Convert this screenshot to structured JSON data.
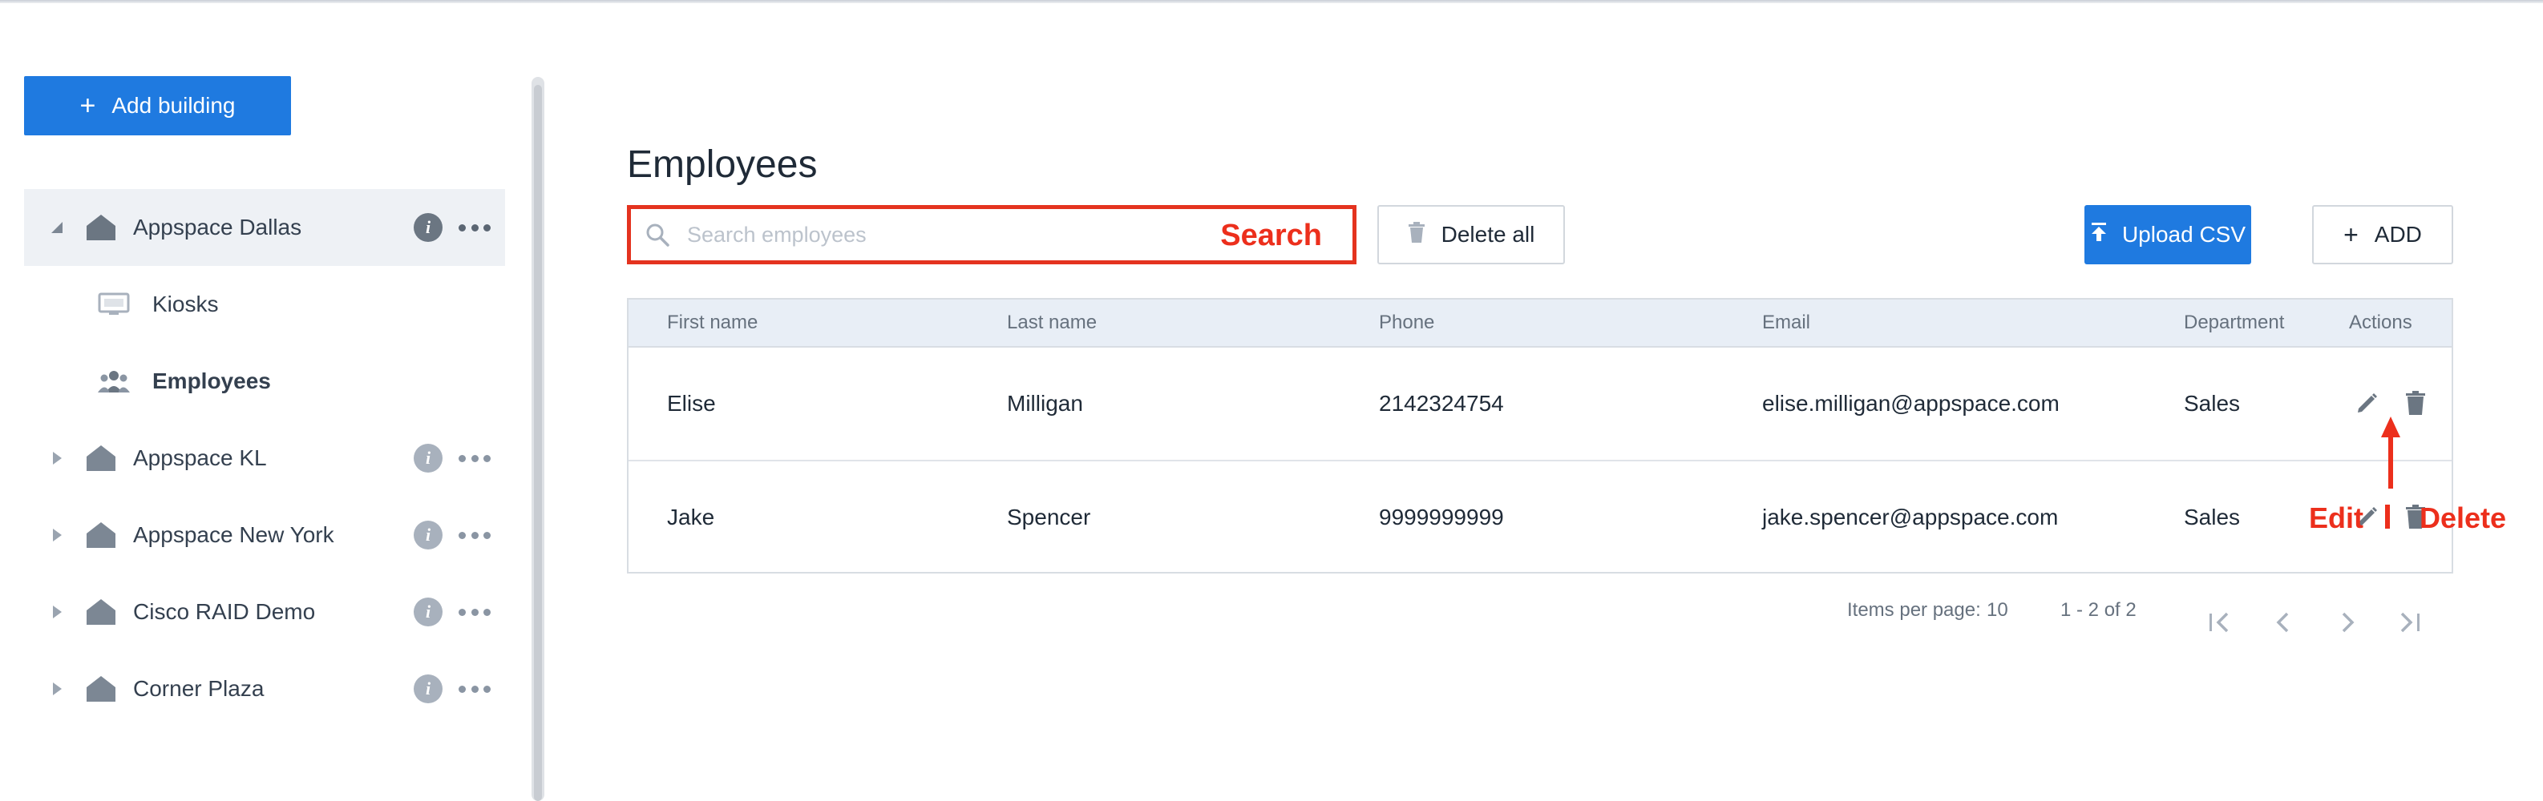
{
  "sidebar": {
    "add_building_label": "Add building",
    "buildings": [
      {
        "label": "Appspace Dallas",
        "expanded": true
      },
      {
        "label": "Appspace KL",
        "expanded": false
      },
      {
        "label": "Appspace New York",
        "expanded": false
      },
      {
        "label": "Cisco RAID Demo",
        "expanded": false
      },
      {
        "label": "Corner Plaza",
        "expanded": false
      }
    ],
    "subitems": [
      {
        "label": "Kiosks",
        "icon": "monitor-icon"
      },
      {
        "label": "Employees",
        "icon": "people-icon",
        "active": true
      }
    ]
  },
  "main": {
    "title": "Employees",
    "search": {
      "placeholder": "Search employees",
      "value": ""
    },
    "delete_all_label": "Delete all",
    "upload_csv_label": "Upload CSV",
    "add_label": "ADD",
    "table": {
      "columns": [
        "First name",
        "Last name",
        "Phone",
        "Email",
        "Department",
        "Actions"
      ],
      "rows": [
        {
          "first": "Elise",
          "last": "Milligan",
          "phone": "2142324754",
          "email": "elise.milligan@appspace.com",
          "department": "Sales"
        },
        {
          "first": "Jake",
          "last": "Spencer",
          "phone": "9999999999",
          "email": "jake.spencer@appspace.com",
          "department": "Sales"
        }
      ]
    },
    "pagination": {
      "items_per_page_label": "Items per page:",
      "items_per_page": "10",
      "range": "1 - 2 of 2"
    }
  },
  "annotations": {
    "search": "Search",
    "edit": "Edit",
    "delete": "Delete"
  },
  "colors": {
    "accent": "#1f7ae0",
    "annotation": "#ec2f1c",
    "header_bg": "#e8eef6",
    "selected_row_bg": "#eef1f5"
  }
}
